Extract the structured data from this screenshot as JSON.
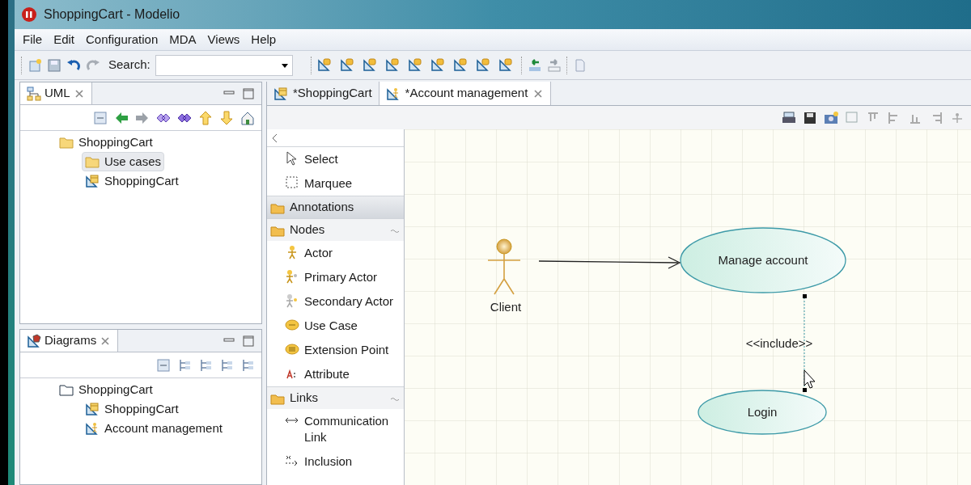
{
  "window": {
    "title": "ShoppingCart - Modelio"
  },
  "menu": [
    "File",
    "Edit",
    "Configuration",
    "MDA",
    "Views",
    "Help"
  ],
  "toolbar": {
    "search_label": "Search:"
  },
  "uml_view": {
    "tab": "UML",
    "tree": [
      {
        "label": "ShoppingCart",
        "kind": "folder",
        "selected": false,
        "children": [
          {
            "label": "Use cases",
            "kind": "folder",
            "selected": true
          },
          {
            "label": "ShoppingCart",
            "kind": "class_diagram",
            "selected": false
          }
        ]
      }
    ]
  },
  "diagrams_view": {
    "tab": "Diagrams",
    "tree": [
      {
        "label": "ShoppingCart",
        "kind": "package",
        "selected": false,
        "children": [
          {
            "label": "ShoppingCart",
            "kind": "class_diagram",
            "selected": false
          },
          {
            "label": "Account management",
            "kind": "usecase_diagram",
            "selected": false
          }
        ]
      }
    ]
  },
  "editor_tabs": [
    {
      "label": "*ShoppingCart",
      "kind": "class_diagram",
      "selected": false
    },
    {
      "label": "*Account management",
      "kind": "usecase_diagram",
      "selected": true
    }
  ],
  "palette": {
    "tools": [
      "Select",
      "Marquee"
    ],
    "groups": [
      {
        "label": "Annotations",
        "expanded": false
      },
      {
        "label": "Nodes",
        "expanded": true,
        "items": [
          "Actor",
          "Primary Actor",
          "Secondary Actor",
          "Use Case",
          "Extension Point",
          "Attribute"
        ]
      },
      {
        "label": "Links",
        "expanded": true,
        "items": [
          "Communication Link",
          "Inclusion"
        ]
      }
    ]
  },
  "diagram": {
    "actors": [
      {
        "label": "Client"
      }
    ],
    "use_cases": [
      {
        "label": "Manage account"
      },
      {
        "label": "Login"
      }
    ],
    "links": [
      {
        "kind": "association"
      },
      {
        "kind": "include",
        "label": "<<include>>"
      }
    ]
  }
}
